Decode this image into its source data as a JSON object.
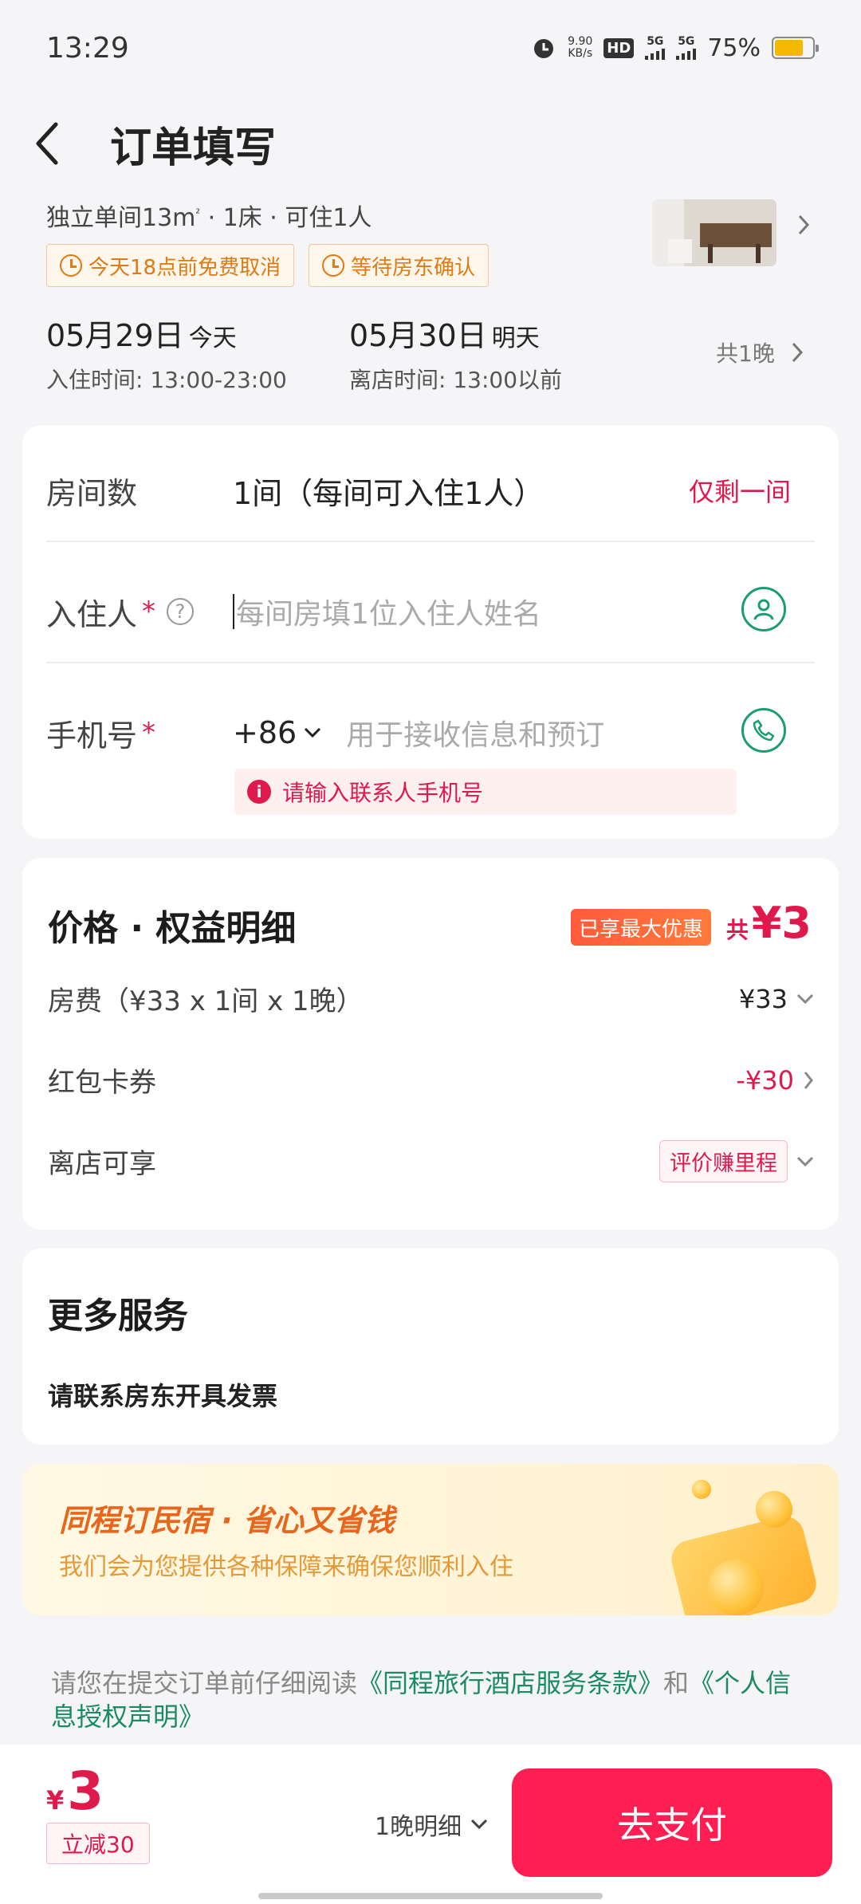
{
  "status": {
    "time": "13:29",
    "net_speed_value": "9.90",
    "net_speed_unit": "KB/s",
    "hd_label": "HD",
    "signal1": "5G",
    "signal2": "5G",
    "battery": "75%",
    "battery_level": 0.75
  },
  "nav": {
    "title": "订单填写"
  },
  "hotel": {
    "room_desc": "独立单间13m",
    "room_desc_sup": "²",
    "room_desc_tail": " · 1床 · 可住1人",
    "tags": [
      "今天18点前免费取消",
      "等待房东确认"
    ],
    "checkin": {
      "date": "05月29日",
      "rel": "今天",
      "time": "入住时间: 13:00-23:00"
    },
    "checkout": {
      "date": "05月30日",
      "rel": "明天",
      "time": "离店时间: 13:00以前"
    },
    "nights": "共1晚"
  },
  "form": {
    "rooms_label": "房间数",
    "rooms_value": "1间（每间可入住1人）",
    "rooms_remaining": "仅剩一间",
    "guest_label": "入住人",
    "guest_placeholder": "每间房填1位入住人姓名",
    "phone_label": "手机号",
    "phone_code": "+86",
    "phone_placeholder": "用于接收信息和预订",
    "required_mark": "*",
    "help_mark": "?",
    "error_text": "请输入联系人手机号",
    "error_icon": "i"
  },
  "price": {
    "title": "价格 · 权益明细",
    "badge": "已享最大优惠",
    "total_prefix": "共",
    "total": "¥3",
    "room_fee_label": "房费（¥33 x 1间 x 1晚）",
    "room_fee_value": "¥33",
    "coupon_label": "红包卡券",
    "coupon_value": "-¥30",
    "checkout_label": "离店可享",
    "checkout_tag": "评价赚里程"
  },
  "services": {
    "title": "更多服务",
    "invoice": "请联系房东开具发票"
  },
  "promo": {
    "title": "同程订民宿 · 省心又省钱",
    "subtitle": "我们会为您提供各种保障来确保您顺利入住"
  },
  "agreement": {
    "prefix": "请您在提交订单前仔细阅读",
    "link1": "《同程旅行酒店服务条款》",
    "middle": "和",
    "link2": "《个人信息授权声明》"
  },
  "bottom": {
    "currency": "¥",
    "price": "3",
    "discount": "立减30",
    "detail": "1晚明细",
    "pay": "去支付"
  },
  "colors": {
    "accent": "#ff1e51",
    "link": "#1a8b63",
    "warning": "#e07a12"
  }
}
